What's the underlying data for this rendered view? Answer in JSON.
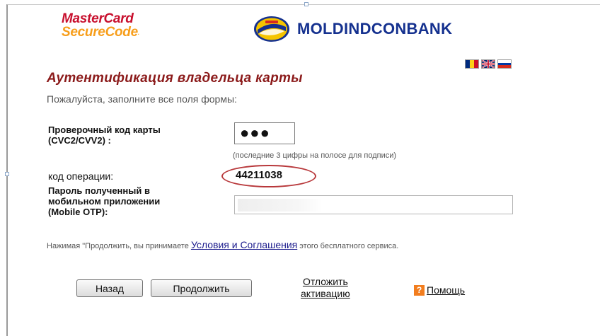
{
  "header": {
    "mastercard": {
      "line1": "MasterCard",
      "line2": "SecureCode",
      "tm": "."
    },
    "bank": {
      "name": "MOLDINDCONBANK",
      "emblem_icon": "bank-emblem-icon"
    }
  },
  "languages": [
    {
      "code": "ro",
      "icon": "romania-flag-icon"
    },
    {
      "code": "en",
      "icon": "uk-flag-icon"
    },
    {
      "code": "ru",
      "icon": "russia-flag-icon"
    }
  ],
  "form": {
    "title": "Аутентификация владельца карты",
    "subtitle": "Пожалуйста, заполните все поля формы:",
    "cvc_label_1": "Проверочный код карты",
    "cvc_label_2": "(CVC2/CVV2) :",
    "cvc_value": "●●●",
    "cvc_hint": "(последние 3 цифры на полосе для подписи)",
    "opcode_label": "код операции:",
    "opcode_value": "44211038",
    "otp_label_1": "Пароль полученный в",
    "otp_label_2": "мобильном приложении",
    "otp_label_3": "(Mobile OTP):",
    "otp_value": ""
  },
  "terms": {
    "prefix": "Нажимая \"Продолжить, вы принимаете ",
    "link": "Условия и Соглашения",
    "suffix": " этого бесплатного сервиса."
  },
  "actions": {
    "back": "Назад",
    "continue": "Продолжить",
    "defer_1": "Отложить",
    "defer_2": "активацию",
    "help_icon_glyph": "?",
    "help": "Помощь"
  },
  "colors": {
    "title": "#8b1a1a",
    "bank_blue": "#15318f",
    "mastercard_red": "#c8102e",
    "mastercard_orange": "#f79e1b",
    "annotation_ring": "#b8383b",
    "help_orange": "#f27d1e"
  }
}
